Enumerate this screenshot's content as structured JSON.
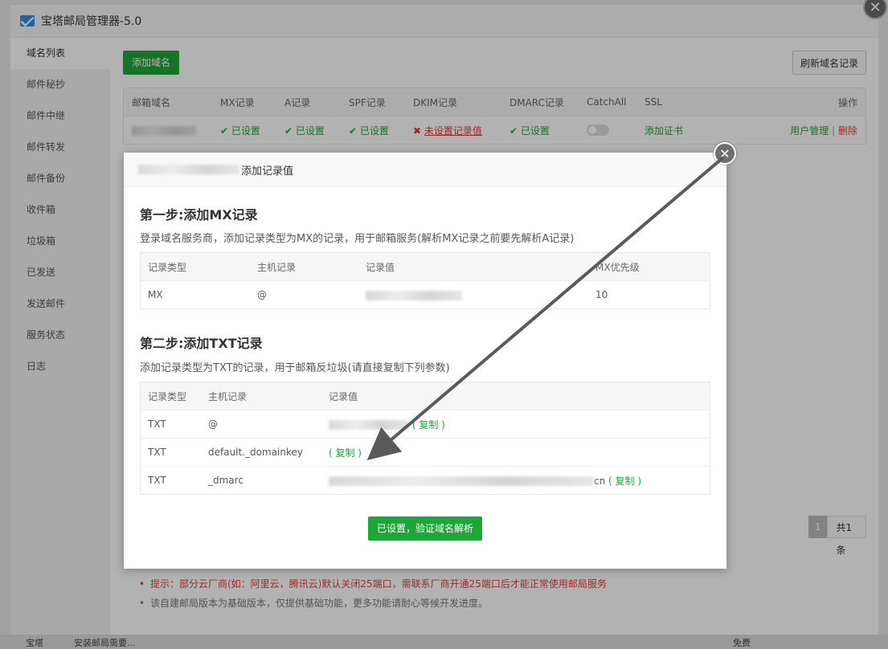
{
  "window": {
    "title": "宝塔邮局管理器-5.0",
    "close_icon": "✕"
  },
  "sidebar": {
    "items": [
      {
        "label": "域名列表"
      },
      {
        "label": "邮件秘抄"
      },
      {
        "label": "邮件中继"
      },
      {
        "label": "邮件转发"
      },
      {
        "label": "邮件备份"
      },
      {
        "label": "收件箱"
      },
      {
        "label": "垃圾箱"
      },
      {
        "label": "已发送"
      },
      {
        "label": "发送邮件"
      },
      {
        "label": "服务状态"
      },
      {
        "label": "日志"
      }
    ]
  },
  "toolbar": {
    "add_domain": "添加域名",
    "refresh": "刷新域名记录"
  },
  "domain_table": {
    "headers": [
      "邮箱域名",
      "MX记录",
      "A记录",
      "SPF记录",
      "DKIM记录",
      "DMARC记录",
      "CatchAll",
      "SSL",
      "操作"
    ],
    "row": {
      "mx": "✔ 已设置",
      "a": "✔ 已设置",
      "spf": "✔ 已设置",
      "dkim_icon": "✖",
      "dkim": "未设置记录值",
      "dmarc": "✔ 已设置",
      "ssl": "添加证书",
      "user_mgmt": "用户管理",
      "sep": "|",
      "delete": "删除"
    }
  },
  "pager": {
    "current": "1",
    "total": "共1条"
  },
  "tips": [
    "提示：部分云厂商(如：阿里云，腾讯云)默认关闭25端口，需联系厂商开通25端口后才能正常使用邮局服务",
    "该自建邮局版本为基础版本，仅提供基础功能，更多功能请耐心等候开发进度。"
  ],
  "bottom": {
    "left": "宝塔",
    "mid": "安装邮局需要...",
    "right": "免费"
  },
  "dialog": {
    "title": "添加记录值",
    "close_icon": "✕",
    "step1": {
      "title": "第一步:添加MX记录",
      "desc": "登录域名服务商，添加记录类型为MX的记录，用于邮箱服务(解析MX记录之前要先解析A记录)",
      "headers": [
        "记录类型",
        "主机记录",
        "记录值",
        "MX优先级"
      ],
      "row": {
        "type": "MX",
        "host": "@",
        "priority": "10"
      }
    },
    "step2": {
      "title": "第二步:添加TXT记录",
      "desc": "添加记录类型为TXT的记录，用于邮箱反垃圾(请直接复制下列参数)",
      "headers": [
        "记录类型",
        "主机记录",
        "记录值"
      ],
      "rows": [
        {
          "type": "TXT",
          "host": "@",
          "suffix": "",
          "copy": "( 复制 )"
        },
        {
          "type": "TXT",
          "host": "default._domainkey",
          "suffix": "",
          "copy": "( 复制 )"
        },
        {
          "type": "TXT",
          "host": "_dmarc",
          "suffix": "cn",
          "copy": "( 复制 )"
        }
      ]
    },
    "verify_button": "已设置，验证域名解析"
  }
}
